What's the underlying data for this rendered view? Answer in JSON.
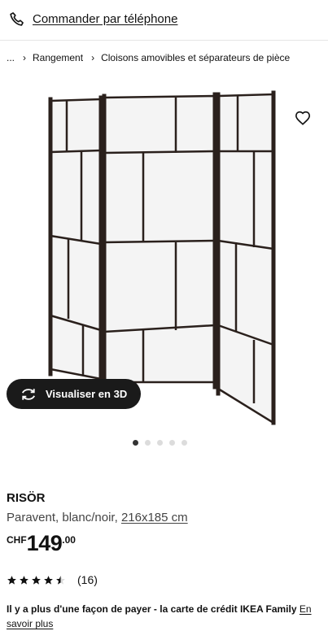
{
  "header": {
    "phone_link": "Commander par téléphone",
    "phone_icon": "phone-icon"
  },
  "breadcrumb": {
    "ellipsis": "...",
    "items": [
      "Rangement",
      "Cloisons amovibles et séparateurs de pièce"
    ]
  },
  "gallery": {
    "image_alt": "RISÖR paravent",
    "view_3d_label": "Visualiser en 3D",
    "slide_count": 5,
    "active_slide": 1
  },
  "product": {
    "name": "RISÖR",
    "description": "Paravent, blanc/noir,",
    "dimensions": "216x185 cm",
    "price": {
      "currency": "CHF",
      "integer": "149",
      "decimal": ".00"
    },
    "rating": {
      "stars": 4.5,
      "max_stars": 5,
      "count": "(16)"
    }
  },
  "payment": {
    "text": "Il y a plus d'une façon de payer - la carte de crédit IKEA Family",
    "more_link": "En savoir plus"
  },
  "colors": {
    "text": "#111111",
    "button_bg": "#1a1a1a",
    "frame": "#2a201c",
    "panel": "#f4f4f4"
  }
}
